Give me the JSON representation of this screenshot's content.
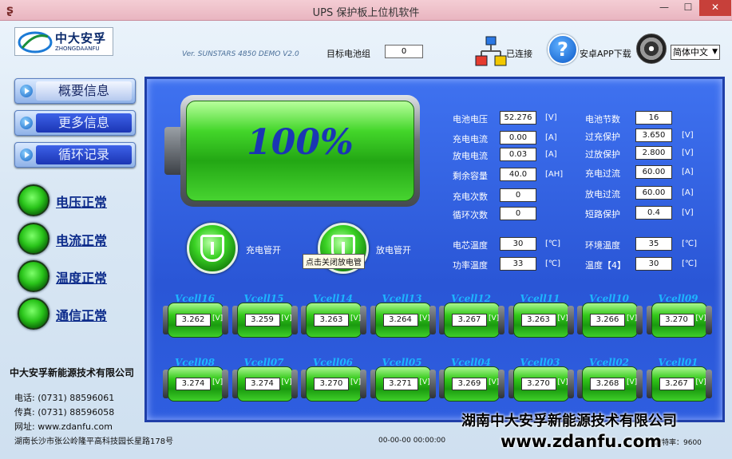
{
  "window": {
    "title": "UPS 保护板上位机软件",
    "min": "—",
    "max": "☐",
    "close": "✕"
  },
  "header": {
    "logo_cn": "中大安孚",
    "logo_en": "ZHONGDAANFU",
    "version": "Ver. SUNSTARS 4850 DEMO V2.0",
    "target_label": "目标电池组",
    "target_value": "0",
    "connected": "已连接",
    "android_download": "安卓APP下载",
    "language": "简体中文"
  },
  "nav": {
    "summary": "概要信息",
    "more": "更多信息",
    "cycle": "循环记录"
  },
  "status": {
    "voltage": "电压正常",
    "current": "电流正常",
    "temperature": "温度正常",
    "comm": "通信正常"
  },
  "company": {
    "name": "中大安孚新能源技术有限公司",
    "phone": "电话: (0731) 88596061",
    "fax": "传真: (0731) 88596058",
    "web": "网址: www.zdanfu.com",
    "address": "湖南长沙市张公岭隆平高科技园长星路178号"
  },
  "battery": {
    "percent": "100%",
    "level": 1.0
  },
  "fields_left": [
    {
      "label": "电池电压",
      "value": "52.276",
      "unit": "[V]"
    },
    {
      "label": "充电电流",
      "value": "0.00",
      "unit": "[A]"
    },
    {
      "label": "放电电流",
      "value": "0.03",
      "unit": "[A]"
    },
    {
      "label": "剩余容量",
      "value": "40.0",
      "unit": "[AH]"
    },
    {
      "label": "充电次数",
      "value": "0",
      "unit": ""
    },
    {
      "label": "循环次数",
      "value": "0",
      "unit": ""
    }
  ],
  "fields_right": [
    {
      "label": "电池节数",
      "value": "16",
      "unit": ""
    },
    {
      "label": "过充保护",
      "value": "3.650",
      "unit": "[V]"
    },
    {
      "label": "过放保护",
      "value": "2.800",
      "unit": "[V]"
    },
    {
      "label": "充电过流",
      "value": "60.00",
      "unit": "[A]"
    },
    {
      "label": "放电过流",
      "value": "60.00",
      "unit": "[A]"
    },
    {
      "label": "短路保护",
      "value": "0.4",
      "unit": "[V]"
    }
  ],
  "temps": {
    "cell_label": "电芯温度",
    "cell_value": "30",
    "cell_unit": "[℃]",
    "power_label": "功率温度",
    "power_value": "33",
    "power_unit": "[℃]",
    "env_label": "环境温度",
    "env_value": "35",
    "env_unit": "[℃]",
    "t4_label": "温度【4】",
    "t4_value": "30",
    "t4_unit": "[℃]"
  },
  "switches": {
    "charge_label": "充电管开",
    "discharge_label": "放电管开",
    "tooltip": "点击关闭放电管"
  },
  "cells_row1": [
    {
      "name": "Vcell16",
      "value": "3.262"
    },
    {
      "name": "Vcell15",
      "value": "3.259"
    },
    {
      "name": "Vcell14",
      "value": "3.263"
    },
    {
      "name": "Vcell13",
      "value": "3.264"
    },
    {
      "name": "Vcell12",
      "value": "3.267"
    },
    {
      "name": "Vcell11",
      "value": "3.263"
    },
    {
      "name": "Vcell10",
      "value": "3.266"
    },
    {
      "name": "Vcell09",
      "value": "3.270"
    }
  ],
  "cells_row2": [
    {
      "name": "Vcell08",
      "value": "3.274"
    },
    {
      "name": "Vcell07",
      "value": "3.274"
    },
    {
      "name": "Vcell06",
      "value": "3.270"
    },
    {
      "name": "Vcell05",
      "value": "3.271"
    },
    {
      "name": "Vcell04",
      "value": "3.269"
    },
    {
      "name": "Vcell03",
      "value": "3.270"
    },
    {
      "name": "Vcell02",
      "value": "3.268"
    },
    {
      "name": "Vcell01",
      "value": "3.267"
    }
  ],
  "cell_unit": "[V]",
  "footer": {
    "datetime": "00-00-00 00:00:00",
    "baud": "波特率：9600",
    "overlay_company": "湖南中大安孚新能源技术有限公司",
    "overlay_url": "www.zdanfu.com"
  }
}
